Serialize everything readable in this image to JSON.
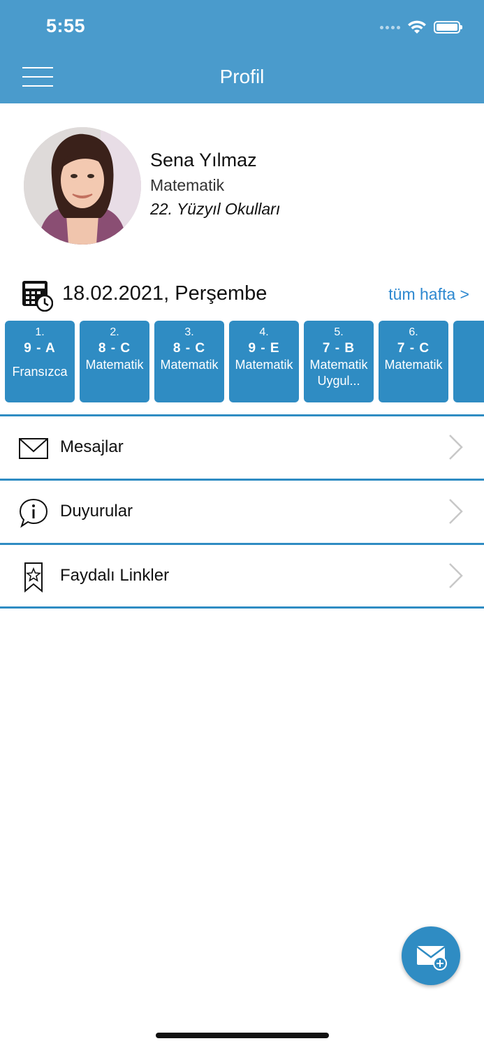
{
  "status_bar": {
    "time": "5:55"
  },
  "header": {
    "title": "Profil"
  },
  "profile": {
    "name": "Sena Yılmaz",
    "subject": "Matematik",
    "school": "22. Yüzyıl Okulları"
  },
  "schedule": {
    "date": "18.02.2021, Perşembe",
    "week_link": "tüm hafta >",
    "lessons": [
      {
        "num": "1.",
        "class": "9 - A",
        "subject": "Fransızca"
      },
      {
        "num": "2.",
        "class": "8 - C",
        "subject": "Matematik"
      },
      {
        "num": "3.",
        "class": "8 - C",
        "subject": "Matematik"
      },
      {
        "num": "4.",
        "class": "9 - E",
        "subject": "Matematik"
      },
      {
        "num": "5.",
        "class": "7 - B",
        "subject": "Matematik Uygul..."
      },
      {
        "num": "6.",
        "class": "7 - C",
        "subject": "Matematik"
      }
    ]
  },
  "menu": {
    "items": [
      {
        "label": "Mesajlar",
        "icon": "envelope-icon"
      },
      {
        "label": "Duyurular",
        "icon": "info-speech-bubble-icon"
      },
      {
        "label": "Faydalı Linkler",
        "icon": "bookmark-star-icon"
      }
    ]
  },
  "colors": {
    "header": "#4a9bcc",
    "accent": "#2f8cc3",
    "link": "#2d88d0"
  }
}
